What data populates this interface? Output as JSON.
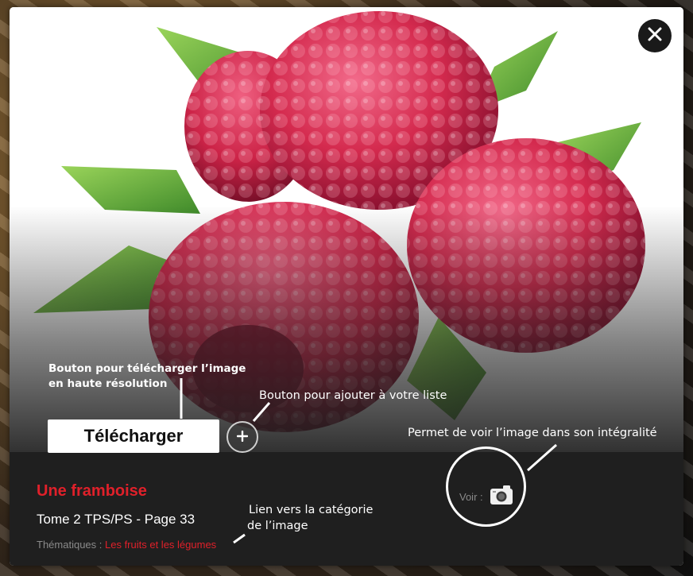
{
  "modal": {
    "close_icon": "close-icon",
    "download_label": "Télécharger",
    "add_icon": "plus-icon",
    "image_title": "Une framboise",
    "image_source": "Tome 2 TPS/PS - Page 33",
    "themes_label": "Thématiques : ",
    "themes_link": "Les fruits et les légumes",
    "view_label": "Voir :",
    "view_icon": "camera-icon"
  },
  "annotations": {
    "download_note_line1": "Bouton pour télécharger l’image",
    "download_note_line2": "en haute résolution",
    "add_note": "Bouton pour ajouter à votre liste",
    "view_note": "Permet de voir l’image dans son intégralité",
    "category_note_line1": "Lien vers la catégorie",
    "category_note_line2": "de l’image"
  },
  "colors": {
    "accent_red": "#e0202a",
    "panel_bg": "#1f1f1f",
    "raspberry": "#d42a4e",
    "leaf": "#6fb63b"
  }
}
